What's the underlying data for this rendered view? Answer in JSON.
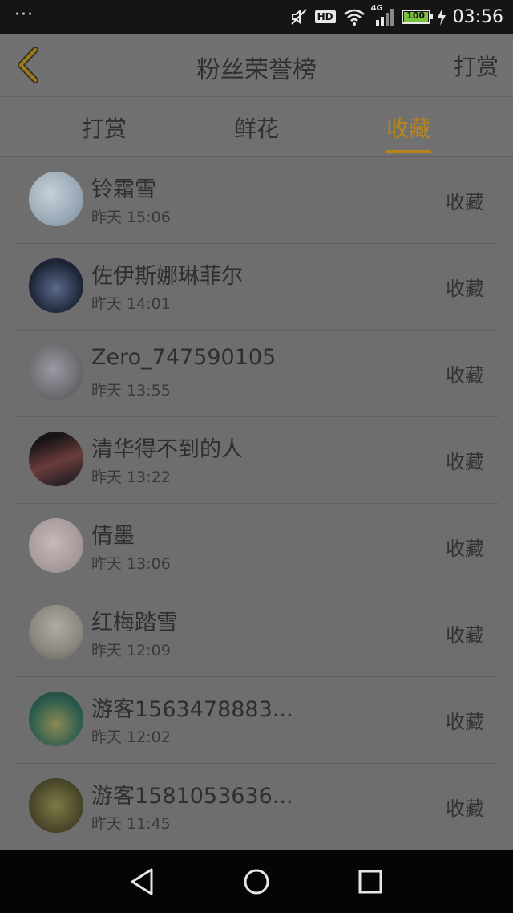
{
  "status_bar": {
    "dots": "···",
    "hd": "HD",
    "network": "4G",
    "battery": "100",
    "time": "03:56"
  },
  "header": {
    "title": "粉丝荣誉榜",
    "action": "打赏"
  },
  "tabs": [
    {
      "label": "打赏",
      "active": false
    },
    {
      "label": "鲜花",
      "active": false
    },
    {
      "label": "收藏",
      "active": true
    }
  ],
  "list": [
    {
      "name": "铃霜雪",
      "time": "昨天 15:06",
      "action": "收藏",
      "avatar_color": "#9aa9b6"
    },
    {
      "name": "佐伊斯娜琳菲尔",
      "time": "昨天 14:01",
      "action": "收藏",
      "avatar_color": "#1d2436"
    },
    {
      "name": "Zero_747590105",
      "time": "昨天 13:55",
      "action": "收藏",
      "avatar_color": "#6f6d74"
    },
    {
      "name": "清华得不到的人",
      "time": "昨天 13:22",
      "action": "收藏",
      "avatar_color": "#2d2229"
    },
    {
      "name": "倩墨",
      "time": "昨天 13:06",
      "action": "收藏",
      "avatar_color": "#a79b9b"
    },
    {
      "name": "红梅踏雪",
      "time": "昨天 12:09",
      "action": "收藏",
      "avatar_color": "#8c8680"
    },
    {
      "name": "游客1563478883...",
      "time": "昨天 12:02",
      "action": "收藏",
      "avatar_color": "#2c5c4f"
    },
    {
      "name": "游客1581053636...",
      "time": "昨天 11:45",
      "action": "收藏",
      "avatar_color": "#4d4a2c"
    }
  ],
  "nav_bar": {
    "icons": [
      "back-triangle-icon",
      "home-circle-icon",
      "recents-square-icon"
    ]
  },
  "colors": {
    "accent": "#b8841c",
    "background": "#6e6e6e"
  }
}
